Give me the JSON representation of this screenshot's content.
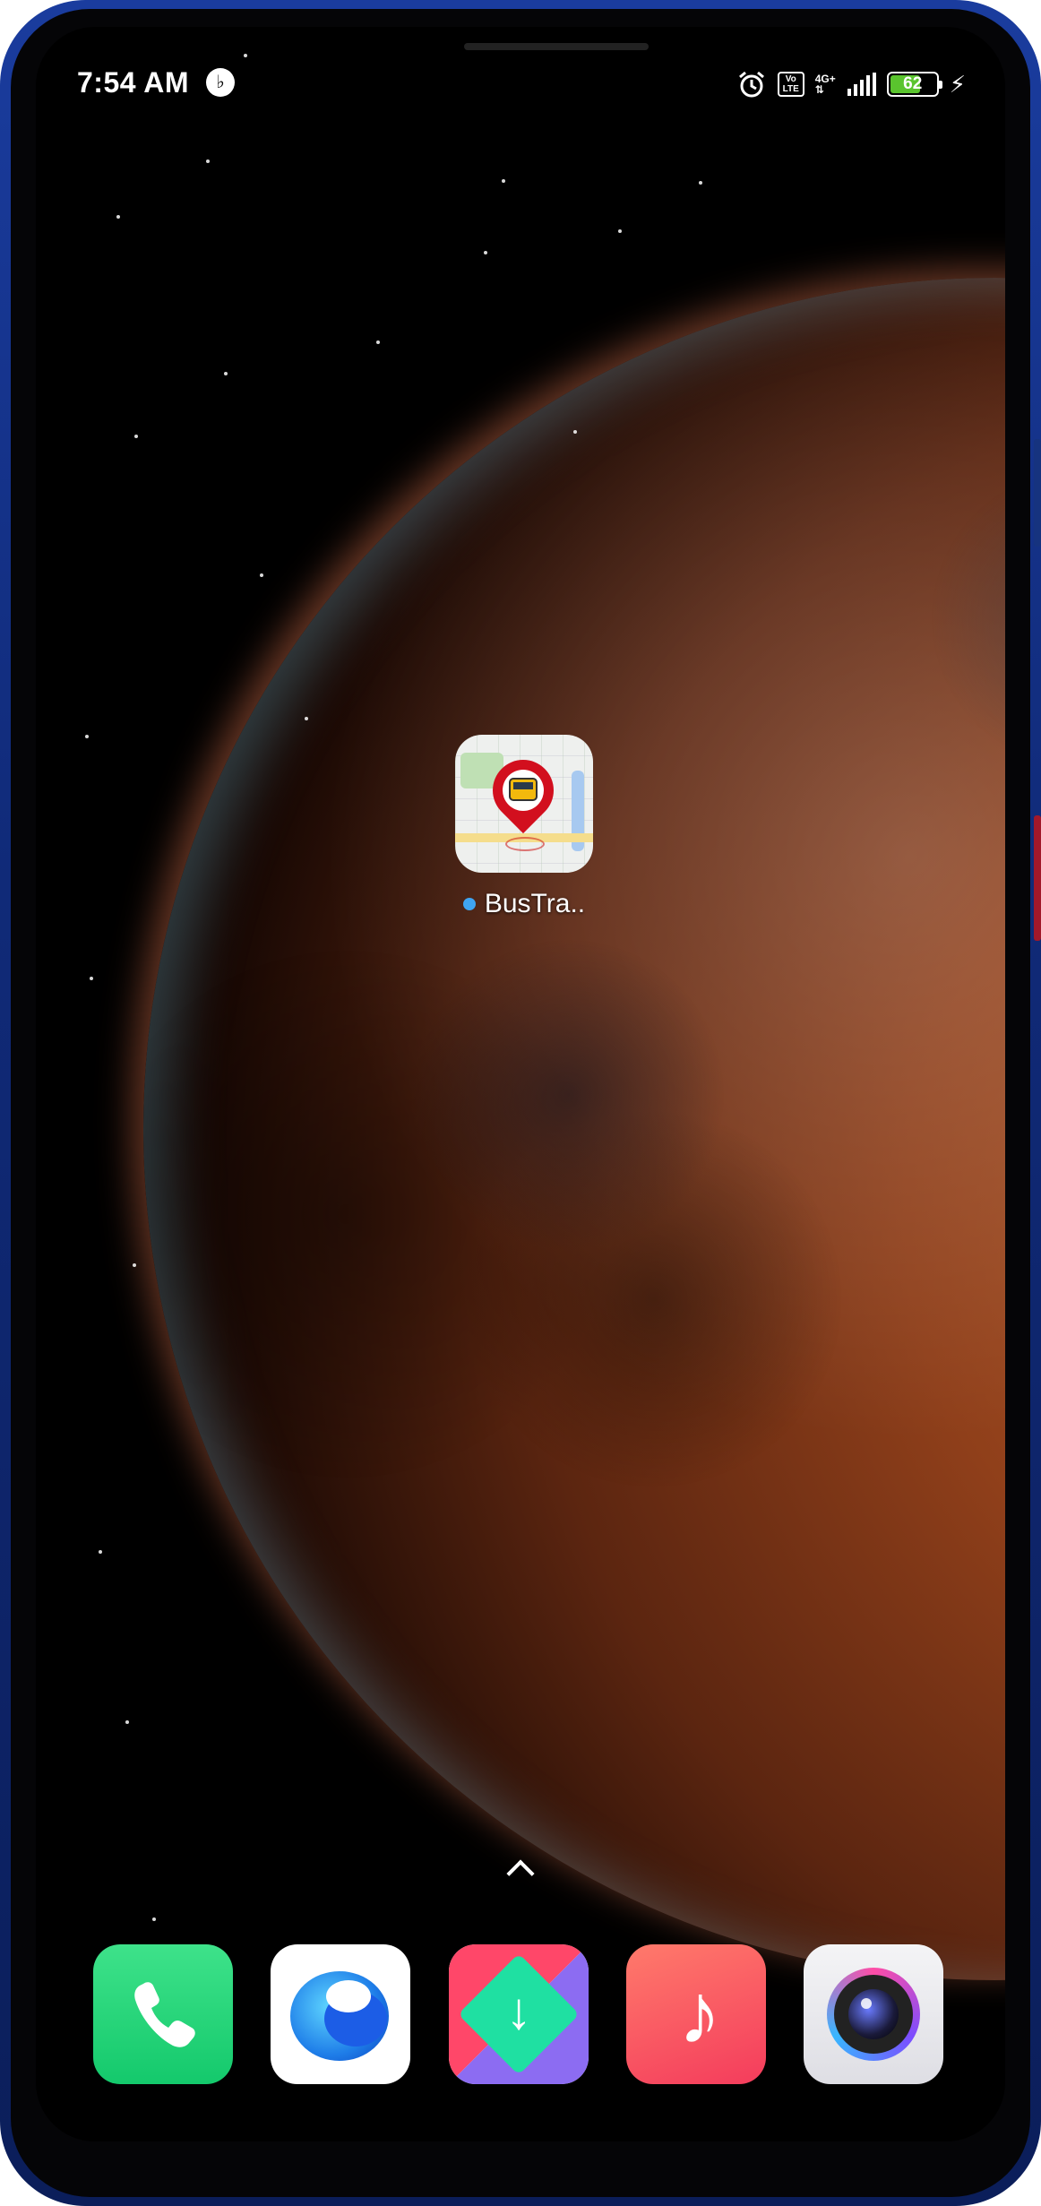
{
  "status_bar": {
    "time": "7:54 AM",
    "notification_icon": "app-notification-icon",
    "alarm_icon": "alarm-clock-icon",
    "volte_label_top": "Vo",
    "volte_label_bottom": "LTE",
    "network_type": "4G+",
    "signal_icon": "signal-bars-icon",
    "battery_level": "62",
    "charging_icon": "lightning-bolt-icon"
  },
  "home": {
    "apps": [
      {
        "label": "BusTra..",
        "icon": "bus-tracker-map-pin-icon",
        "new_badge_color": "#3fa5f2"
      }
    ],
    "app_drawer_icon": "chevron-up-icon"
  },
  "dock": {
    "apps": [
      {
        "icon": "phone-icon",
        "color": "#14c96c"
      },
      {
        "icon": "browser-icon",
        "color": "#1c5de6"
      },
      {
        "icon": "app-store-icon",
        "color": "#1fe0a2"
      },
      {
        "icon": "music-icon",
        "color": "#f43c5c"
      },
      {
        "icon": "camera-icon",
        "color": "#7c4dff"
      }
    ]
  },
  "device": {
    "frame_color": "#102a78"
  }
}
